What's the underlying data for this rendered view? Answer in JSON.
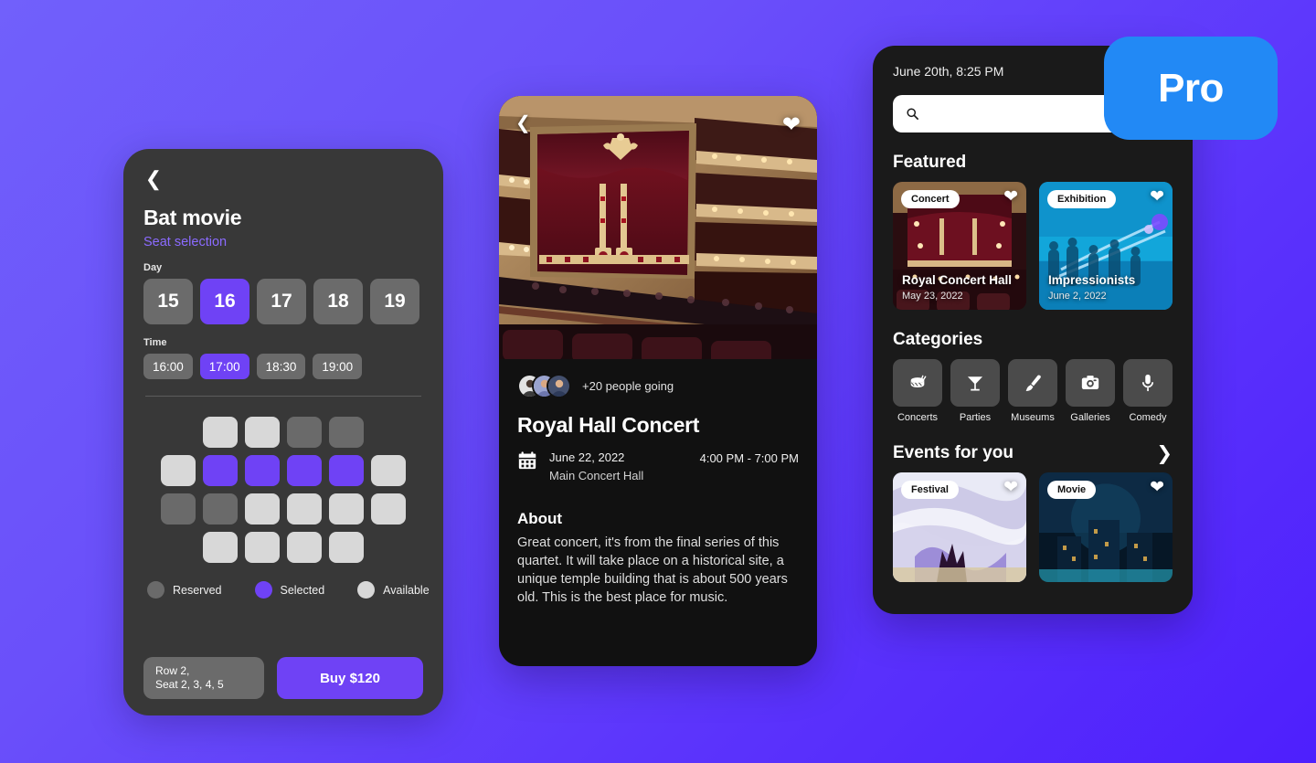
{
  "pro_badge": {
    "label": "Pro"
  },
  "seat_screen": {
    "back_icon": "chevron-left-icon",
    "title": "Bat movie",
    "subtitle": "Seat selection",
    "day_label": "Day",
    "days": [
      {
        "value": "15",
        "selected": false
      },
      {
        "value": "16",
        "selected": true
      },
      {
        "value": "17",
        "selected": false
      },
      {
        "value": "18",
        "selected": false
      },
      {
        "value": "19",
        "selected": false
      }
    ],
    "time_label": "Time",
    "times": [
      {
        "value": "16:00",
        "selected": false
      },
      {
        "value": "17:00",
        "selected": true
      },
      {
        "value": "18:30",
        "selected": false
      },
      {
        "value": "19:00",
        "selected": false
      }
    ],
    "seat_rows": [
      [
        "gap",
        "available",
        "available",
        "reserved",
        "reserved",
        "gap"
      ],
      [
        "available",
        "selected",
        "selected",
        "selected",
        "selected",
        "available"
      ],
      [
        "reserved",
        "reserved",
        "available",
        "available",
        "available",
        "available"
      ],
      [
        "gap",
        "available",
        "available",
        "available",
        "available",
        "gap"
      ]
    ],
    "legend": [
      {
        "key": "reserved",
        "label": "Reserved",
        "color": "#6a6a6a"
      },
      {
        "key": "selected",
        "label": "Selected",
        "color": "#6F42F5"
      },
      {
        "key": "available",
        "label": "Available",
        "color": "#d8d8d8"
      }
    ],
    "summary_line1": "Row 2,",
    "summary_line2": "Seat 2, 3, 4, 5",
    "buy_label": "Buy $120"
  },
  "event_screen": {
    "back_icon": "chevron-left-icon",
    "favorite_icon": "heart-icon",
    "hero_alt": "royal-opera-house-interior",
    "going_text": "+20 people going",
    "title": "Royal Hall Concert",
    "calendar_icon": "calendar-icon",
    "date": "June 22, 2022",
    "venue": "Main Concert Hall",
    "time_range": "4:00 PM - 7:00 PM",
    "about_heading": "About",
    "about_text": "Great concert, it's from the final series of this quartet. It will take place on a historical site, a unique temple building that is about 500 years old. This is the best place for music."
  },
  "discover_screen": {
    "clock": "June 20th, 8:25 PM",
    "search": {
      "icon": "search-icon",
      "placeholder": "",
      "value": ""
    },
    "featured_heading": "Featured",
    "featured": [
      {
        "badge": "Concert",
        "name": "Royal Concert Hall",
        "date": "May 23, 2022",
        "favorite_icon": "heart-icon",
        "theme": "concert-hall"
      },
      {
        "badge": "Exhibition",
        "name": "Impressionists",
        "date": "June 2, 2022",
        "favorite_icon": "heart-icon",
        "theme": "exhibition"
      }
    ],
    "categories_heading": "Categories",
    "categories": [
      {
        "label": "Concerts",
        "icon": "drum-icon"
      },
      {
        "label": "Parties",
        "icon": "cocktail-icon"
      },
      {
        "label": "Museums",
        "icon": "paintbrush-icon"
      },
      {
        "label": "Galleries",
        "icon": "camera-icon"
      },
      {
        "label": "Comedy",
        "icon": "microphone-icon"
      }
    ],
    "events_heading": "Events for you",
    "events_arrow_icon": "chevron-right-icon",
    "events": [
      {
        "badge": "Festival",
        "favorite_icon": "heart-icon",
        "theme": "festival"
      },
      {
        "badge": "Movie",
        "favorite_icon": "heart-icon",
        "theme": "movie"
      }
    ]
  },
  "colors": {
    "accent_purple": "#6F42F5",
    "pro_blue": "#2289F5",
    "seat_available": "#d8d8d8",
    "seat_reserved": "#6a6a6a",
    "bg_gradient_from": "#7160FB",
    "bg_gradient_to": "#4E1FFD"
  }
}
